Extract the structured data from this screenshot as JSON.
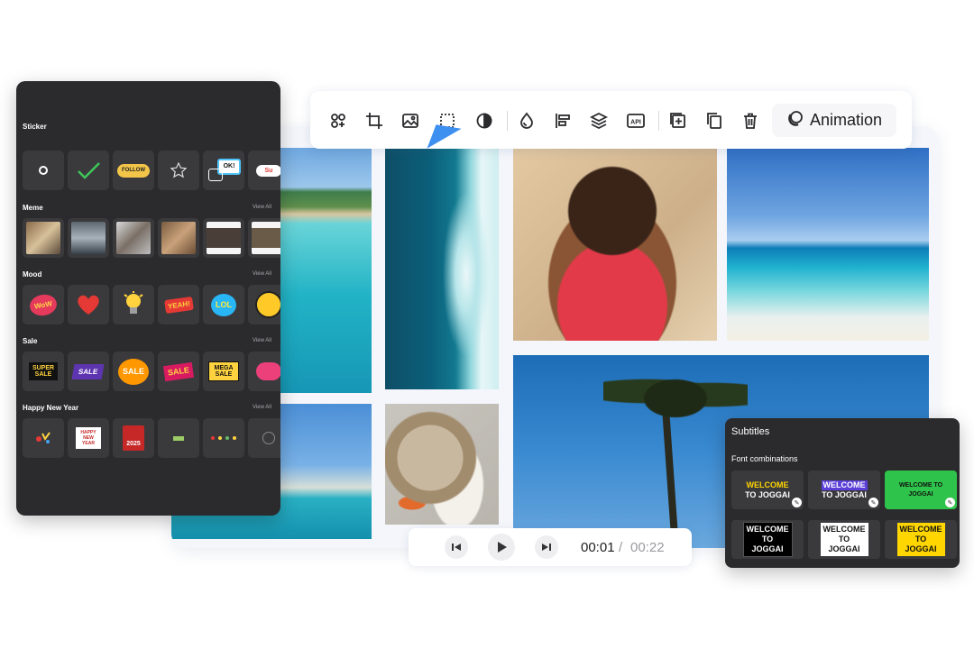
{
  "toolbar": {
    "tools": [
      {
        "name": "focus-icon"
      },
      {
        "name": "crop-icon"
      },
      {
        "name": "image-icon"
      },
      {
        "name": "selection-icon"
      },
      {
        "name": "contrast-icon"
      },
      {
        "name": "drop-icon"
      },
      {
        "name": "align-icon"
      },
      {
        "name": "layers-icon"
      },
      {
        "name": "api-icon",
        "label": "API"
      },
      {
        "name": "add-icon"
      },
      {
        "name": "duplicate-icon"
      },
      {
        "name": "delete-icon"
      }
    ],
    "animation_label": "Animation",
    "accent_color": "#3d8ff0"
  },
  "sticker_panel": {
    "sections": [
      {
        "title": "Sticker",
        "view_all": ""
      },
      {
        "title": "Meme",
        "view_all": "View All"
      },
      {
        "title": "Mood",
        "view_all": "View All"
      },
      {
        "title": "Sale",
        "view_all": "View All"
      },
      {
        "title": "Happy New Year",
        "view_all": "View All"
      }
    ],
    "sticker_texts": {
      "follow": "FOLLOW",
      "ok": "OK!",
      "subscribe": "Su",
      "wow": "WoW",
      "yeah": "YEAH!",
      "lol": "LOL",
      "super_sale": "SUPER SALE",
      "sale": "SALE",
      "clearance": "SALE",
      "super_sale_2": "SALE",
      "mega_sale": "MEGA SALE",
      "happy_new_year": "HAPPY NEW YEAR",
      "year": "2025"
    }
  },
  "player": {
    "current_time": "00:01",
    "separator": "/",
    "total_time": "00:22"
  },
  "subtitles": {
    "title": "Subtitles",
    "font_combinations_label": "Font combinations",
    "combos": [
      {
        "line1": "WELCOME",
        "line2": "TO JOGGAI"
      },
      {
        "line1": "WELCOME",
        "line2": "TO JOGGAI"
      },
      {
        "line1": "WELCOME TO",
        "line2": "JOGGAI"
      },
      {
        "line1": "WELCOME",
        "line2": "TO",
        "line3": "JOGGAI"
      },
      {
        "line1": "WELCOME",
        "line2": "TO",
        "line3": "JOGGAI"
      },
      {
        "line1": "WELCOME",
        "line2": "TO",
        "line3": "JOGGAI"
      }
    ]
  }
}
